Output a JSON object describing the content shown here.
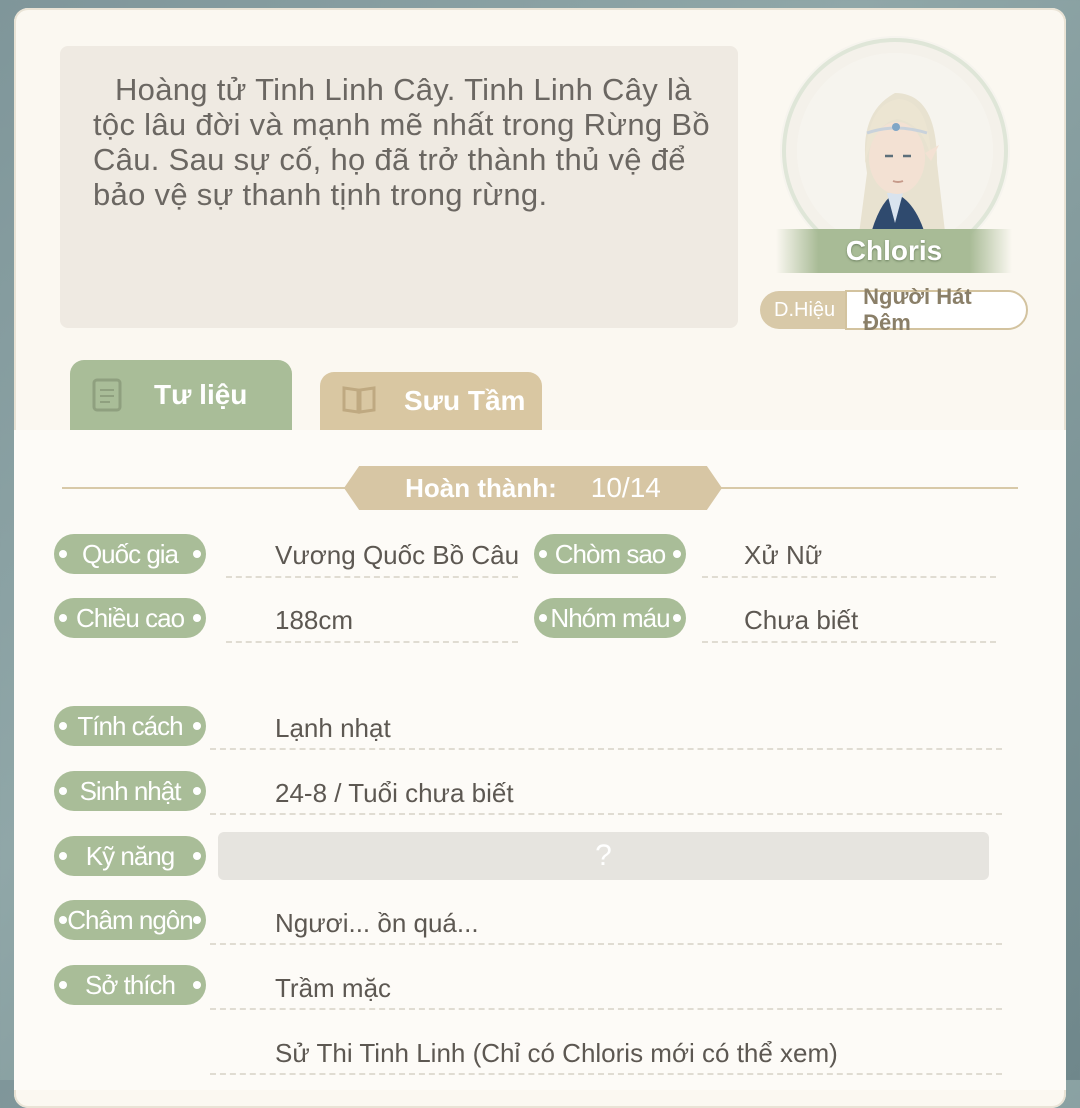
{
  "description": "Hoàng tử Tinh Linh Cây. Tinh Linh Cây là tộc lâu đời và mạnh mẽ nhất trong Rừng Bồ Câu. Sau sự cố, họ đã trở thành thủ vệ để bảo vệ sự thanh tịnh trong rừng.",
  "character": {
    "name": "Chloris",
    "title_tag": "D.Hiệu",
    "title_value": "Người Hát Đêm"
  },
  "tabs": [
    {
      "label": "Tư liệu",
      "icon": "document-icon",
      "active": true
    },
    {
      "label": "Sưu Tầm",
      "icon": "book-icon",
      "active": false
    }
  ],
  "progress": {
    "label": "Hoàn thành:",
    "value": "10/14"
  },
  "fields": {
    "country": {
      "label": "Quốc gia",
      "value": "Vương Quốc Bồ Câu"
    },
    "constellation": {
      "label": "Chòm sao",
      "value": "Xử Nữ"
    },
    "height": {
      "label": "Chiều cao",
      "value": "188cm"
    },
    "blood_type": {
      "label": "Nhóm máu",
      "value": "Chưa biết"
    },
    "personality": {
      "label": "Tính cách",
      "value": "Lạnh nhạt"
    },
    "birthday": {
      "label": "Sinh nhật",
      "value": "24-8 / Tuổi chưa biết"
    },
    "skill": {
      "label": "Kỹ năng",
      "value": "?"
    },
    "motto": {
      "label": "Châm ngôn",
      "value": "Ngươi... ồn quá..."
    },
    "hobby": {
      "label": "Sở thích",
      "value": "Trầm mặc"
    },
    "extra": {
      "value": "Sử Thi Tinh Linh (Chỉ có Chloris mới có thể xem)"
    }
  },
  "colors": {
    "accent_green": "#a9bd98",
    "accent_tan": "#d7c6a4",
    "panel_bg": "#fbf8f1"
  }
}
